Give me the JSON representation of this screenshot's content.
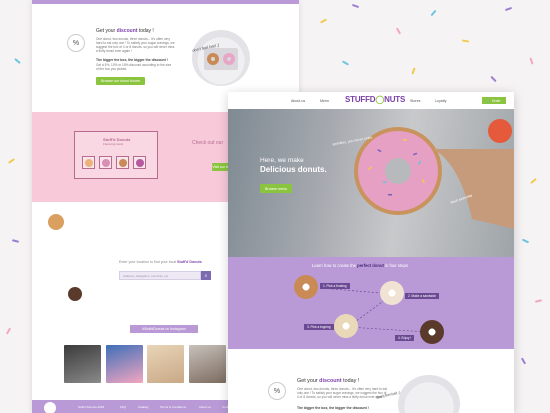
{
  "back_page": {
    "discount": {
      "title_prefix": "Get your ",
      "title_highlight": "discount",
      "title_suffix": " today !",
      "paragraph": "One donut, two donuts, three donuts... It's often very hard to eat only one ! To satisfy your sugar cravings, we suggest the box of 4 or 8 donuts, so you will never miss a fluffy donut ever again !",
      "bold_paragraph": "The bigger the box, the bigger the discount !",
      "small_paragraph": "Get a 5%, 10% or 15% discount according to the size of the box you picked.",
      "button_label": "Browse our donut boxes",
      "handwritten_note": "don't feel bad ;)"
    },
    "stuffd_card": {
      "title": "Stuff'd Donuts",
      "subtitle": "Flavoring stock"
    },
    "checkout": {
      "title": "Check out our",
      "button_label": "Visit our boxes"
    },
    "search": {
      "prompt_prefix": "Enter your location to find your local ",
      "prompt_brand": "Stuff'd Donuts",
      "placeholder": "Address, delegation, town/city, etc"
    },
    "hashtag": "#StuffdDonuts on Instagram",
    "footer": {
      "items": [
        "Stuff'd Donuts 2018",
        "FAQ",
        "Catalog",
        "Terms & Conditions",
        "About us",
        "Contact us"
      ]
    }
  },
  "front_page": {
    "nav": {
      "items": [
        "About us",
        "Menu",
        "Stores",
        "Loyalty"
      ],
      "logo_main": "STUFFD",
      "logo_accent": "NUTS",
      "order_label": "Order"
    },
    "hero": {
      "line1": "Here, we make",
      "line2": "Delicious donuts.",
      "handwritten_top": "sprinkles, you never smile",
      "handwritten_bottom": "fresh everyday",
      "button_label": "Browse menu"
    },
    "steps": {
      "title_prefix": "Learn how to create the ",
      "title_highlight": "perfect donut",
      "title_suffix": " in four steps",
      "items": [
        {
          "label": "1. Pick a frosting"
        },
        {
          "label": "2. Make a sandwich"
        },
        {
          "label": "3. Pick a topping"
        },
        {
          "label": "4. Enjoy !"
        }
      ]
    },
    "discount": {
      "title_prefix": "Get your ",
      "title_highlight": "discount",
      "title_suffix": " today !",
      "paragraph": "One donut, two donuts, three donuts... It's often very hard to eat only one ! To satisfy your sugar cravings, we suggest the box of 4 or 8 donuts, so you will never miss a fluffy donut ever again !",
      "bold_paragraph": "The bigger the box, the bigger the discount !",
      "handwritten_note": "don't feel bad ;)"
    }
  },
  "colors": {
    "brand_purple": "#b99ad6",
    "brand_dark_purple": "#7b3fa9",
    "brand_green": "#8bc53f",
    "pink_band": "#f7c9d9"
  }
}
